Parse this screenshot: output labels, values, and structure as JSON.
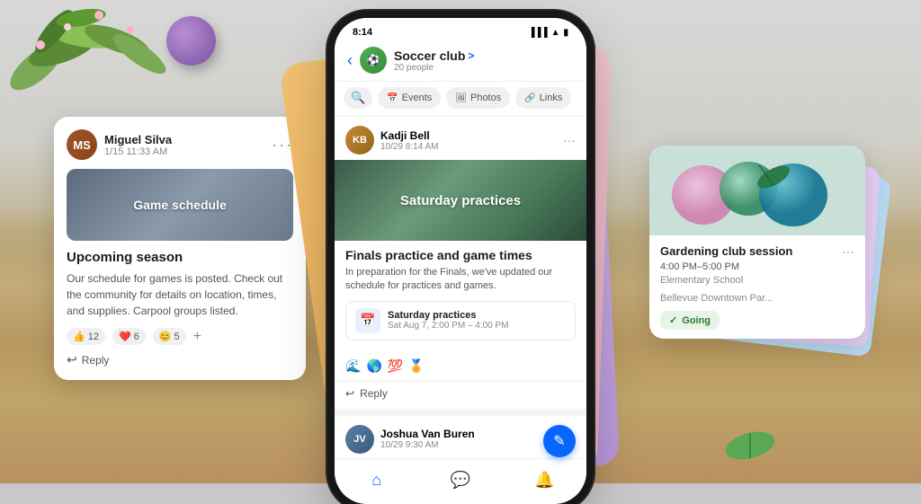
{
  "background": {
    "top_color": "#d8d8d8",
    "bottom_color": "#b89060"
  },
  "left_card": {
    "user": {
      "name": "Miguel Silva",
      "date": "1/15 11:33 AM",
      "avatar_initials": "MS"
    },
    "image_label": "Game schedule",
    "title": "Upcoming season",
    "body": "Our schedule for games is posted. Check out the community for details on location, times, and supplies. Carpool groups listed.",
    "reactions": {
      "thumbs": "12",
      "hearts": "6",
      "icons": "5"
    },
    "reply_label": "Reply",
    "more_options": "···"
  },
  "phone": {
    "status_bar": {
      "time": "8:14",
      "signal": "●●●",
      "wifi": "▲",
      "battery": "■"
    },
    "nav": {
      "back_icon": "‹",
      "group_name": "Soccer club",
      "group_name_chevron": ">",
      "group_members": "20 people"
    },
    "tabs": [
      {
        "label": "🔍",
        "type": "search",
        "active": false
      },
      {
        "label": "Events",
        "icon": "📅",
        "active": false
      },
      {
        "label": "Photos",
        "icon": "🖼",
        "active": false
      },
      {
        "label": "Links",
        "icon": "🔗",
        "active": false
      }
    ],
    "post1": {
      "user": {
        "name": "Kadji Bell",
        "date": "10/29 8:14 AM",
        "avatar_initials": "KB"
      },
      "image_label": "Saturday practices",
      "title": "Finals practice and game times",
      "body": "In preparation for the Finals, we've updated our schedule for practices and games.",
      "event": {
        "name": "Saturday practices",
        "date": "Sat Aug 7, 2:00 PM – 4:00 PM"
      },
      "reactions": [
        "🌊",
        "🌎",
        "💯",
        "🏅"
      ],
      "reply_label": "Reply",
      "more_options": "···"
    },
    "post2": {
      "user": {
        "name": "Joshua Van Buren",
        "date": "10/29 9:30 AM",
        "avatar_initials": "JV"
      }
    },
    "fab_icon": "✎",
    "bottom_nav": {
      "home_icon": "⌂",
      "chat_icon": "💬",
      "bell_icon": "🔔"
    }
  },
  "right_card": {
    "title": "Gardening club session",
    "time": "4:00 PM–5:00 PM",
    "location": "Elementary School",
    "location2": "Bellevue Downtown Par...",
    "going_label": "Going",
    "more_options": "···"
  },
  "labels": {
    "reply": "Reply",
    "going": "Going"
  }
}
